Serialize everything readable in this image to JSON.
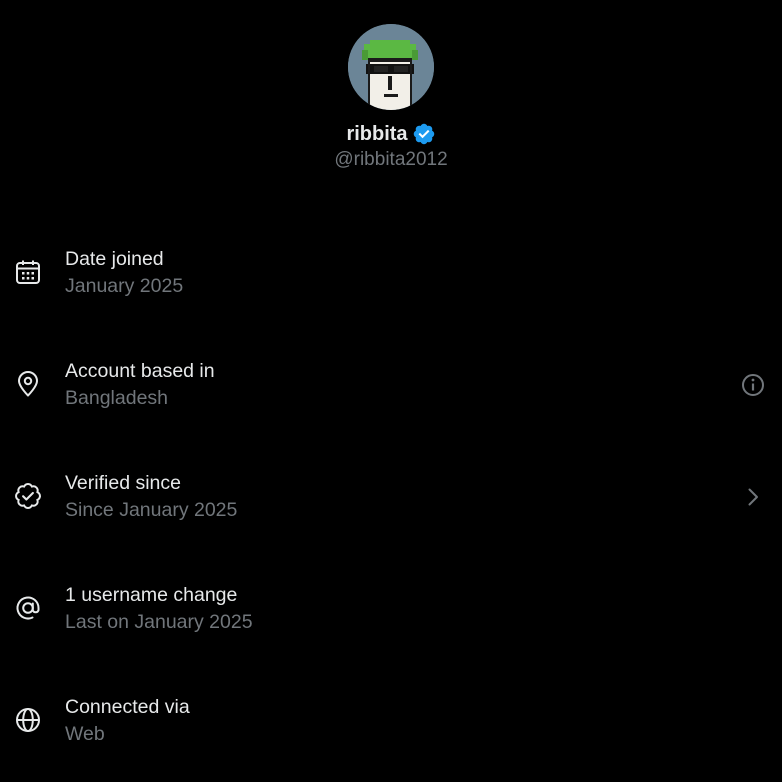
{
  "profile": {
    "display_name": "ribbita",
    "handle": "@ribbita2012",
    "verified": true,
    "avatar_icon": "pixel-punk-avatar-icon",
    "colors": {
      "verified_badge": "#1d9bf0",
      "avatar_background": "#6b8597",
      "avatar_hair": "#5bb843"
    }
  },
  "rows": [
    {
      "label": "Date joined",
      "value": "January 2025",
      "icon": "calendar-icon"
    },
    {
      "label": "Account based in",
      "value": "Bangladesh",
      "icon": "location-pin-icon",
      "action_icon": "info-icon"
    },
    {
      "label": "Verified since",
      "value": "Since January 2025",
      "icon": "verified-check-icon",
      "action_icon": "chevron-right-icon"
    },
    {
      "label": "1 username change",
      "value": "Last on January 2025",
      "icon": "at-sign-icon"
    },
    {
      "label": "Connected via",
      "value": "Web",
      "icon": "globe-icon"
    }
  ],
  "colors": {
    "background": "#000000",
    "primary_text": "#e7e9ea",
    "secondary_text": "#71767b"
  }
}
